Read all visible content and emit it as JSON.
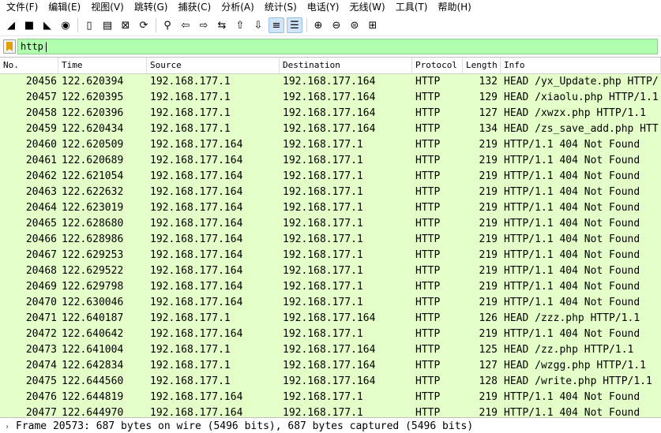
{
  "menu": [
    "文件(F)",
    "编辑(E)",
    "视图(V)",
    "跳转(G)",
    "捕获(C)",
    "分析(A)",
    "统计(S)",
    "电话(Y)",
    "无线(W)",
    "工具(T)",
    "帮助(H)"
  ],
  "toolbar": [
    {
      "icon": "shark-fin-start-icon",
      "glyph": "◢"
    },
    {
      "icon": "stop-icon",
      "glyph": "■"
    },
    {
      "icon": "restart-icon",
      "glyph": "◣"
    },
    {
      "icon": "options-gear-icon",
      "glyph": "◉"
    },
    {
      "sep": true
    },
    {
      "icon": "open-file-icon",
      "glyph": "▯"
    },
    {
      "icon": "save-file-icon",
      "glyph": "▤"
    },
    {
      "icon": "close-file-icon",
      "glyph": "⊠"
    },
    {
      "icon": "reload-icon",
      "glyph": "⟳"
    },
    {
      "sep": true
    },
    {
      "icon": "find-packet-icon",
      "glyph": "⚲"
    },
    {
      "icon": "go-back-icon",
      "glyph": "⇦"
    },
    {
      "icon": "go-forward-icon",
      "glyph": "⇨"
    },
    {
      "icon": "go-to-packet-icon",
      "glyph": "⇆"
    },
    {
      "icon": "go-first-icon",
      "glyph": "⇧"
    },
    {
      "icon": "go-last-icon",
      "glyph": "⇩"
    },
    {
      "icon": "autoscroll-icon",
      "glyph": "≡",
      "active": true
    },
    {
      "icon": "colorize-icon",
      "glyph": "☰",
      "active": true
    },
    {
      "sep": true
    },
    {
      "icon": "zoom-in-icon",
      "glyph": "⊕"
    },
    {
      "icon": "zoom-out-icon",
      "glyph": "⊖"
    },
    {
      "icon": "zoom-normal-icon",
      "glyph": "⊜"
    },
    {
      "icon": "resize-columns-icon",
      "glyph": "⊞"
    }
  ],
  "filter": {
    "value": "http"
  },
  "columns": [
    "No.",
    "Time",
    "Source",
    "Destination",
    "Protocol",
    "Length",
    "Info"
  ],
  "packets": [
    {
      "no": "20456",
      "time": "122.620394",
      "src": "192.168.177.1",
      "dst": "192.168.177.164",
      "proto": "HTTP",
      "len": "132",
      "info": "HEAD /yx_Update.php HTTP/"
    },
    {
      "no": "20457",
      "time": "122.620395",
      "src": "192.168.177.1",
      "dst": "192.168.177.164",
      "proto": "HTTP",
      "len": "129",
      "info": "HEAD /xiaolu.php HTTP/1.1"
    },
    {
      "no": "20458",
      "time": "122.620396",
      "src": "192.168.177.1",
      "dst": "192.168.177.164",
      "proto": "HTTP",
      "len": "127",
      "info": "HEAD /xwzx.php HTTP/1.1"
    },
    {
      "no": "20459",
      "time": "122.620434",
      "src": "192.168.177.1",
      "dst": "192.168.177.164",
      "proto": "HTTP",
      "len": "134",
      "info": "HEAD /zs_save_add.php HTT"
    },
    {
      "no": "20460",
      "time": "122.620509",
      "src": "192.168.177.164",
      "dst": "192.168.177.1",
      "proto": "HTTP",
      "len": "219",
      "info": "HTTP/1.1 404 Not Found"
    },
    {
      "no": "20461",
      "time": "122.620689",
      "src": "192.168.177.164",
      "dst": "192.168.177.1",
      "proto": "HTTP",
      "len": "219",
      "info": "HTTP/1.1 404 Not Found"
    },
    {
      "no": "20462",
      "time": "122.621054",
      "src": "192.168.177.164",
      "dst": "192.168.177.1",
      "proto": "HTTP",
      "len": "219",
      "info": "HTTP/1.1 404 Not Found"
    },
    {
      "no": "20463",
      "time": "122.622632",
      "src": "192.168.177.164",
      "dst": "192.168.177.1",
      "proto": "HTTP",
      "len": "219",
      "info": "HTTP/1.1 404 Not Found"
    },
    {
      "no": "20464",
      "time": "122.623019",
      "src": "192.168.177.164",
      "dst": "192.168.177.1",
      "proto": "HTTP",
      "len": "219",
      "info": "HTTP/1.1 404 Not Found"
    },
    {
      "no": "20465",
      "time": "122.628680",
      "src": "192.168.177.164",
      "dst": "192.168.177.1",
      "proto": "HTTP",
      "len": "219",
      "info": "HTTP/1.1 404 Not Found"
    },
    {
      "no": "20466",
      "time": "122.628986",
      "src": "192.168.177.164",
      "dst": "192.168.177.1",
      "proto": "HTTP",
      "len": "219",
      "info": "HTTP/1.1 404 Not Found"
    },
    {
      "no": "20467",
      "time": "122.629253",
      "src": "192.168.177.164",
      "dst": "192.168.177.1",
      "proto": "HTTP",
      "len": "219",
      "info": "HTTP/1.1 404 Not Found"
    },
    {
      "no": "20468",
      "time": "122.629522",
      "src": "192.168.177.164",
      "dst": "192.168.177.1",
      "proto": "HTTP",
      "len": "219",
      "info": "HTTP/1.1 404 Not Found"
    },
    {
      "no": "20469",
      "time": "122.629798",
      "src": "192.168.177.164",
      "dst": "192.168.177.1",
      "proto": "HTTP",
      "len": "219",
      "info": "HTTP/1.1 404 Not Found"
    },
    {
      "no": "20470",
      "time": "122.630046",
      "src": "192.168.177.164",
      "dst": "192.168.177.1",
      "proto": "HTTP",
      "len": "219",
      "info": "HTTP/1.1 404 Not Found"
    },
    {
      "no": "20471",
      "time": "122.640187",
      "src": "192.168.177.1",
      "dst": "192.168.177.164",
      "proto": "HTTP",
      "len": "126",
      "info": "HEAD /zzz.php HTTP/1.1"
    },
    {
      "no": "20472",
      "time": "122.640642",
      "src": "192.168.177.164",
      "dst": "192.168.177.1",
      "proto": "HTTP",
      "len": "219",
      "info": "HTTP/1.1 404 Not Found"
    },
    {
      "no": "20473",
      "time": "122.641004",
      "src": "192.168.177.1",
      "dst": "192.168.177.164",
      "proto": "HTTP",
      "len": "125",
      "info": "HEAD /zz.php HTTP/1.1"
    },
    {
      "no": "20474",
      "time": "122.642834",
      "src": "192.168.177.1",
      "dst": "192.168.177.164",
      "proto": "HTTP",
      "len": "127",
      "info": "HEAD /wzgg.php HTTP/1.1"
    },
    {
      "no": "20475",
      "time": "122.644560",
      "src": "192.168.177.1",
      "dst": "192.168.177.164",
      "proto": "HTTP",
      "len": "128",
      "info": "HEAD /write.php HTTP/1.1"
    },
    {
      "no": "20476",
      "time": "122.644819",
      "src": "192.168.177.164",
      "dst": "192.168.177.1",
      "proto": "HTTP",
      "len": "219",
      "info": "HTTP/1.1 404 Not Found"
    },
    {
      "no": "20477",
      "time": "122.644970",
      "src": "192.168.177.164",
      "dst": "192.168.177.1",
      "proto": "HTTP",
      "len": "219",
      "info": "HTTP/1.1 404 Not Found"
    }
  ],
  "detail": {
    "arrow": "›",
    "text": "Frame 20573: 687 bytes on wire (5496 bits), 687 bytes captured (5496 bits)"
  },
  "colors": {
    "row_bg": "#e4ffc7",
    "filter_bg": "#afffaf"
  }
}
